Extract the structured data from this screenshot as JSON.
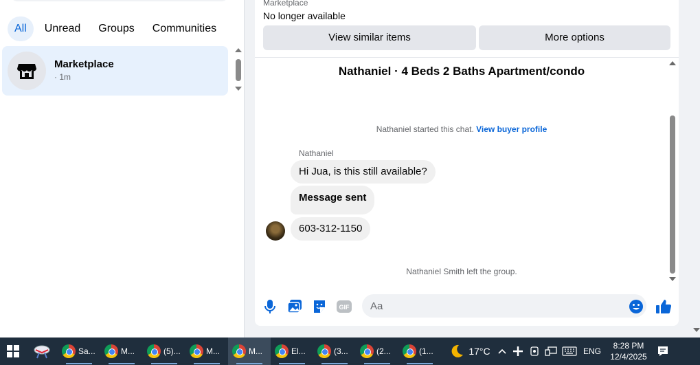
{
  "sidebar": {
    "filters": [
      "All",
      "Unread",
      "Groups",
      "Communities"
    ],
    "active_filter": "All",
    "conversation": {
      "title": "Marketplace",
      "time": "· 1m"
    }
  },
  "chat": {
    "listing": {
      "label": "Marketplace",
      "status": "No longer available",
      "button_similar": "View similar items",
      "button_more": "More options"
    },
    "title": "Nathaniel · 4 Beds 2 Baths Apartment/condo",
    "started_text": "Nathaniel started this chat.",
    "started_link": "View buyer profile",
    "sender": "Nathaniel",
    "messages": [
      {
        "text": "Hi Jua, is this still available?"
      },
      {
        "text": "Message sent"
      },
      {
        "text": "603-312-1150"
      }
    ],
    "left_group": "Nathaniel Smith left the group.",
    "composer": {
      "placeholder": "Aa",
      "icons": [
        "microphone-icon",
        "image-icon",
        "sticker-icon",
        "gif-icon",
        "emoji-icon",
        "like-icon"
      ],
      "gif_label": "GIF"
    }
  },
  "taskbar": {
    "apps": [
      {
        "label": "Sa...",
        "icon": "chrome-icon"
      },
      {
        "label": "M...",
        "icon": "chrome-icon"
      },
      {
        "label": "(5)...",
        "icon": "chrome-icon"
      },
      {
        "label": "M...",
        "icon": "chrome-icon"
      },
      {
        "label": "M...",
        "icon": "chrome-icon",
        "active": true
      },
      {
        "label": "El...",
        "icon": "chrome-icon"
      },
      {
        "label": "(3...",
        "icon": "chrome-icon"
      },
      {
        "label": "(2...",
        "icon": "chrome-icon"
      },
      {
        "label": "(1...",
        "icon": "chrome-icon"
      }
    ],
    "weather": "17°C",
    "language": "ENG",
    "time": "8:28 PM",
    "date": "12/4/2025"
  },
  "colors": {
    "accent": "#0a66d8",
    "taskbar": "#1f2e3d",
    "active_chip_bg": "#e7f0fb"
  }
}
